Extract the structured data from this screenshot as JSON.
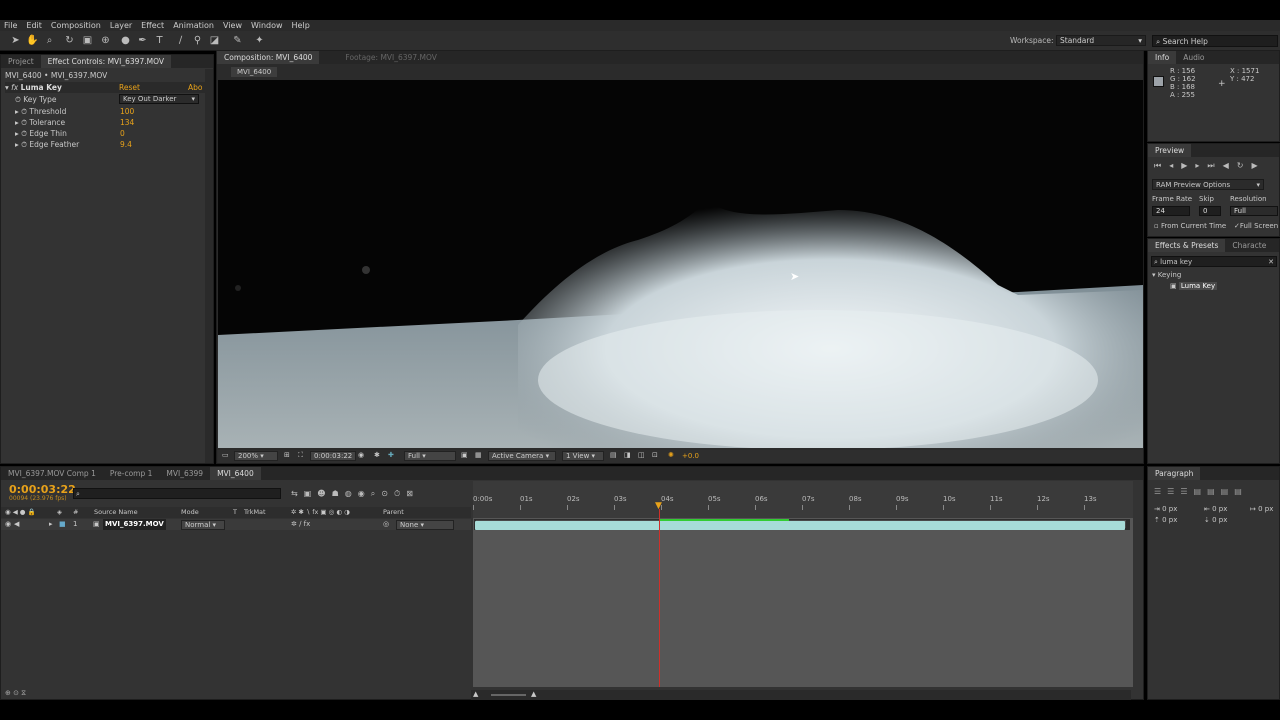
{
  "menu": [
    "File",
    "Edit",
    "Composition",
    "Layer",
    "Effect",
    "Animation",
    "View",
    "Window",
    "Help"
  ],
  "workspace": {
    "label": "Workspace:",
    "value": "Standard"
  },
  "search_help": "Search Help",
  "left_panel": {
    "tabs": [
      "Project",
      "Effect Controls: MVI_6397.MOV"
    ],
    "subtitle": "MVI_6400 • MVI_6397.MOV",
    "effect": {
      "name": "Luma Key",
      "reset": "Reset",
      "about": "Abo"
    },
    "props": [
      {
        "name": "Key Type",
        "value": "Key Out Darker"
      },
      {
        "name": "Threshold",
        "value": "100"
      },
      {
        "name": "Tolerance",
        "value": "134"
      },
      {
        "name": "Edge Thin",
        "value": "0"
      },
      {
        "name": "Edge Feather",
        "value": "9.4"
      }
    ]
  },
  "comp_panel": {
    "tabs": [
      "Composition: MVI_6400",
      "Footage: MVI_6397.MOV"
    ],
    "comp_label": "MVI_6400",
    "zoom": "200%",
    "timecode": "0:00:03:22",
    "resolution": "Full",
    "camera": "Active Camera",
    "view": "1 View",
    "exposure": "+0.0"
  },
  "info": {
    "tabs": [
      "Info",
      "Audio"
    ],
    "r": "R : 156",
    "g": "G : 162",
    "b": "B : 168",
    "a": "A : 255",
    "x": "X : 1571",
    "y": "Y : 472",
    "swatch": "#9ca2a8"
  },
  "preview": {
    "tab": "Preview",
    "ram": "RAM Preview Options",
    "frame_rate_label": "Frame Rate",
    "skip_label": "Skip",
    "resolution_label": "Resolution",
    "frame_rate": "24",
    "skip": "0",
    "resolution": "Full",
    "from_current": "From Current Time",
    "full_screen": "Full Screen"
  },
  "effects_presets": {
    "tabs": [
      "Effects & Presets",
      "Characte"
    ],
    "search": "luma key",
    "category": "Keying",
    "item": "Luma Key"
  },
  "timeline": {
    "tabs": [
      "MVI_6397.MOV Comp 1",
      "Pre-comp 1",
      "MVI_6399",
      "MVI_6400"
    ],
    "timecode": "0:00:03:22",
    "frame_info": "00094 (23.976 fps)",
    "search_placeholder": "",
    "columns": {
      "num": "#",
      "source": "Source Name",
      "mode": "Mode",
      "t": "T",
      "trkmat": "TrkMat",
      "parent": "Parent"
    },
    "layer": {
      "num": "1",
      "name": "MVI_6397.MOV",
      "mode": "Normal",
      "parent": "None"
    },
    "ticks": [
      "0:00s",
      "01s",
      "02s",
      "03s",
      "04s",
      "05s",
      "06s",
      "07s",
      "08s",
      "09s",
      "10s",
      "11s",
      "12s",
      "13s"
    ]
  },
  "paragraph": {
    "tab": "Paragraph",
    "values": [
      "0 px",
      "0 px",
      "0 px",
      "0 px",
      "0 px"
    ]
  },
  "colors": {
    "accent": "#e8a21a",
    "layer_bar": "#a7dcd8",
    "playhead": "#d0302a"
  }
}
